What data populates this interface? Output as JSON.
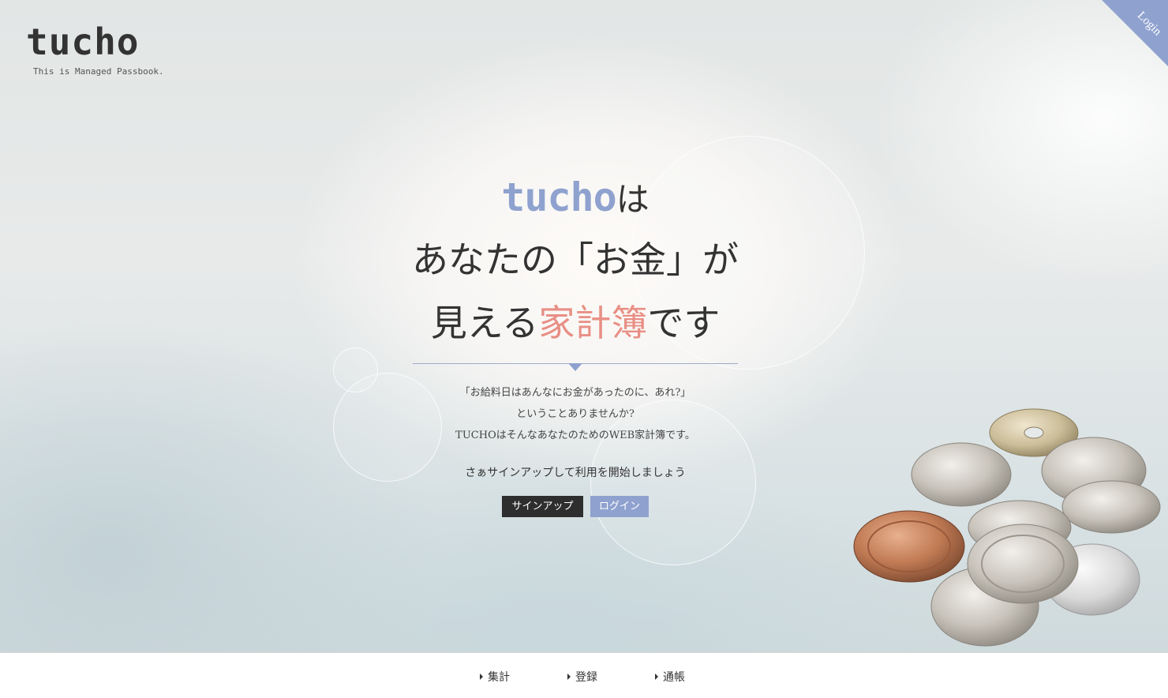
{
  "logo": {
    "title": "tucho",
    "subtitle": "This is Managed Passbook."
  },
  "corner_login": "Login",
  "headline": {
    "brand": "tucho",
    "line1_suffix": "は",
    "line2": "あなたの「お金」が",
    "line3_prefix": "見える",
    "line3_accent": "家計簿",
    "line3_suffix": "です"
  },
  "description": {
    "line1": "「お給料日はあんなにお金があったのに、あれ?」",
    "line2": "ということありませんか?",
    "line3": "TUCHOはそんなあなたのためのWEB家計簿です。"
  },
  "cta": "さぁサインアップして利用を開始しましょう",
  "buttons": {
    "signup": "サインアップ",
    "login": "ログイン"
  },
  "footer_nav": [
    {
      "label": "集計"
    },
    {
      "label": "登録"
    },
    {
      "label": "通帳"
    }
  ],
  "colors": {
    "accent_blue": "#8fa2cf",
    "accent_pink": "#e88f85",
    "dark": "#2e2e2e"
  }
}
